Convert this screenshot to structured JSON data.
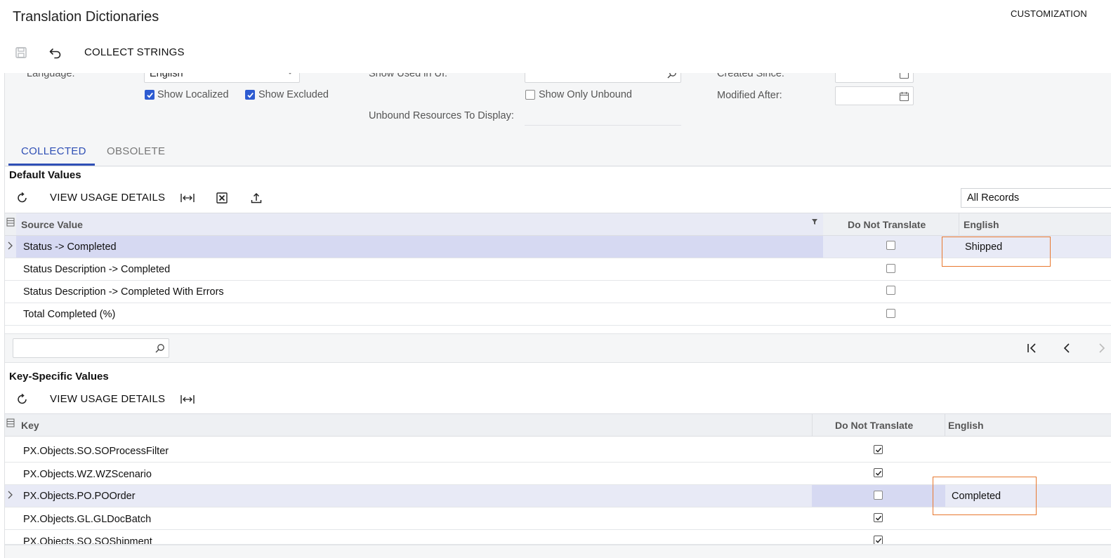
{
  "header": {
    "title": "Translation Dictionaries",
    "customization": "CUSTOMIZATION",
    "collect_strings": "COLLECT STRINGS",
    "icons": [
      "save-icon",
      "undo-icon"
    ]
  },
  "filters": {
    "language_label": "Language:",
    "language_value": "English",
    "show_used_in_ui_label": "Show Used in UI:",
    "created_since_label": "Created Since:",
    "show_localized": {
      "label": "Show Localized",
      "checked": true
    },
    "show_excluded": {
      "label": "Show Excluded",
      "checked": true
    },
    "show_only_unbound": {
      "label": "Show Only Unbound",
      "checked": false
    },
    "modified_after_label": "Modified After:",
    "unbound_resources_label": "Unbound Resources To Display:"
  },
  "tabs": [
    {
      "label": "COLLECTED",
      "active": true
    },
    {
      "label": "OBSOLETE",
      "active": false
    }
  ],
  "default_values": {
    "title": "Default Values",
    "view_usage_details": "VIEW USAGE DETAILS",
    "records_filter": "All Records",
    "columns": {
      "source_value": "Source Value",
      "do_not_translate": "Do Not Translate",
      "english": "English"
    },
    "rows": [
      {
        "source": "Status -> Completed",
        "do_not_translate": false,
        "english": "Shipped",
        "selected": true
      },
      {
        "source": "Status Description -> Completed",
        "do_not_translate": false,
        "english": "",
        "selected": false
      },
      {
        "source": "Status Description -> Completed With Errors",
        "do_not_translate": false,
        "english": "",
        "selected": false
      },
      {
        "source": "Total Completed (%)",
        "do_not_translate": false,
        "english": "",
        "selected": false
      }
    ],
    "search_placeholder": ""
  },
  "key_specific": {
    "title": "Key-Specific Values",
    "view_usage_details": "VIEW USAGE DETAILS",
    "columns": {
      "key": "Key",
      "do_not_translate": "Do Not Translate",
      "english": "English"
    },
    "rows": [
      {
        "key": "PX.Objects.SO.SOProcessFilter",
        "do_not_translate": true,
        "english": "",
        "selected": false
      },
      {
        "key": "PX.Objects.WZ.WZScenario",
        "do_not_translate": true,
        "english": "",
        "selected": false
      },
      {
        "key": "PX.Objects.PO.POOrder",
        "do_not_translate": false,
        "english": "Completed",
        "selected": true
      },
      {
        "key": "PX.Objects.GL.GLDocBatch",
        "do_not_translate": true,
        "english": "",
        "selected": false
      },
      {
        "key": "PX.Objects.SO.SOShipment",
        "do_not_translate": true,
        "english": "",
        "selected": false
      }
    ]
  },
  "colors": {
    "accent": "#2f4fb5",
    "highlight": "#e8782f",
    "selected_row": "#e8eaf6"
  }
}
